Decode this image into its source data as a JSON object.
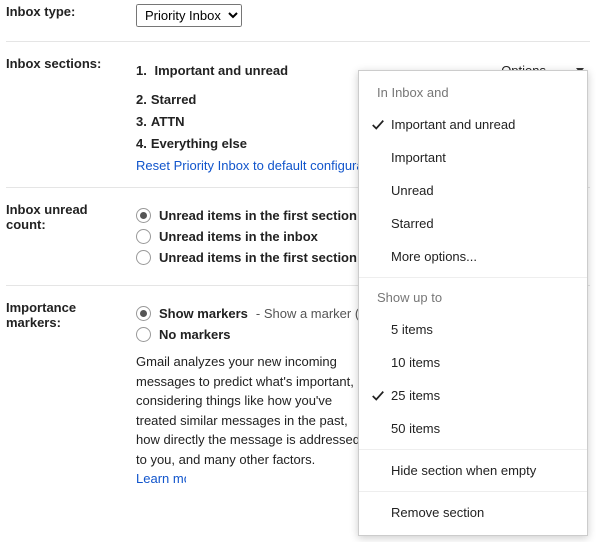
{
  "labels": {
    "inbox_type": "Inbox type:",
    "inbox_sections": "Inbox sections:",
    "unread_count": "Inbox unread count:",
    "importance": "Importance markers:"
  },
  "inbox_type": {
    "selected": "Priority Inbox"
  },
  "options_button": "Options",
  "sections": [
    {
      "n": "1.",
      "name": "Important and unread"
    },
    {
      "n": "2.",
      "name": "Starred"
    },
    {
      "n": "3.",
      "name": "ATTN"
    },
    {
      "n": "4.",
      "name": "Everything else"
    }
  ],
  "reset_link": "Reset Priority Inbox to default configuration",
  "unread_options": [
    "Unread items in the first section",
    "Unread items in the inbox",
    "Unread items in the first section and inbox"
  ],
  "markers": {
    "show_label": "Show markers",
    "show_desc": " - Show a marker (",
    "show_desc2": ")",
    "hide_label": "No markers",
    "explain": "Gmail analyzes your new incoming messages to predict what's important, considering things like how you've treated similar messages in the past, how directly the message is addressed to you, and many other factors. ",
    "learn": "Learn more"
  },
  "dropdown": {
    "header1": "In Inbox and",
    "filter": [
      {
        "label": "Important and unread",
        "checked": true
      },
      {
        "label": "Important",
        "checked": false
      },
      {
        "label": "Unread",
        "checked": false
      },
      {
        "label": "Starred",
        "checked": false
      },
      {
        "label": "More options...",
        "checked": false
      }
    ],
    "header2": "Show up to",
    "limit": [
      {
        "label": "5 items",
        "checked": false
      },
      {
        "label": "10 items",
        "checked": false
      },
      {
        "label": "25 items",
        "checked": true
      },
      {
        "label": "50 items",
        "checked": false
      }
    ],
    "hide": "Hide section when empty",
    "remove": "Remove section"
  }
}
